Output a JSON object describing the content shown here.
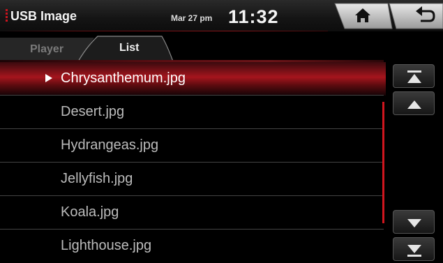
{
  "header": {
    "app_title": "USB Image",
    "date": "Mar 27 pm",
    "time": "11:32"
  },
  "tabs": [
    {
      "label": "Player",
      "active": false
    },
    {
      "label": "List",
      "active": true
    }
  ],
  "files": [
    {
      "name": "Chrysanthemum.jpg",
      "selected": true
    },
    {
      "name": "Desert.jpg",
      "selected": false
    },
    {
      "name": "Hydrangeas.jpg",
      "selected": false
    },
    {
      "name": "Jellyfish.jpg",
      "selected": false
    },
    {
      "name": "Koala.jpg",
      "selected": false
    },
    {
      "name": "Lighthouse.jpg",
      "selected": false
    }
  ],
  "icons": {
    "home": "home-icon",
    "back": "back-icon",
    "scroll_top": "scroll-top-icon",
    "scroll_up": "scroll-up-icon",
    "scroll_down": "scroll-down-icon",
    "scroll_bottom": "scroll-bottom-icon"
  },
  "colors": {
    "accent_red": "#c8141e",
    "background": "#000000"
  }
}
